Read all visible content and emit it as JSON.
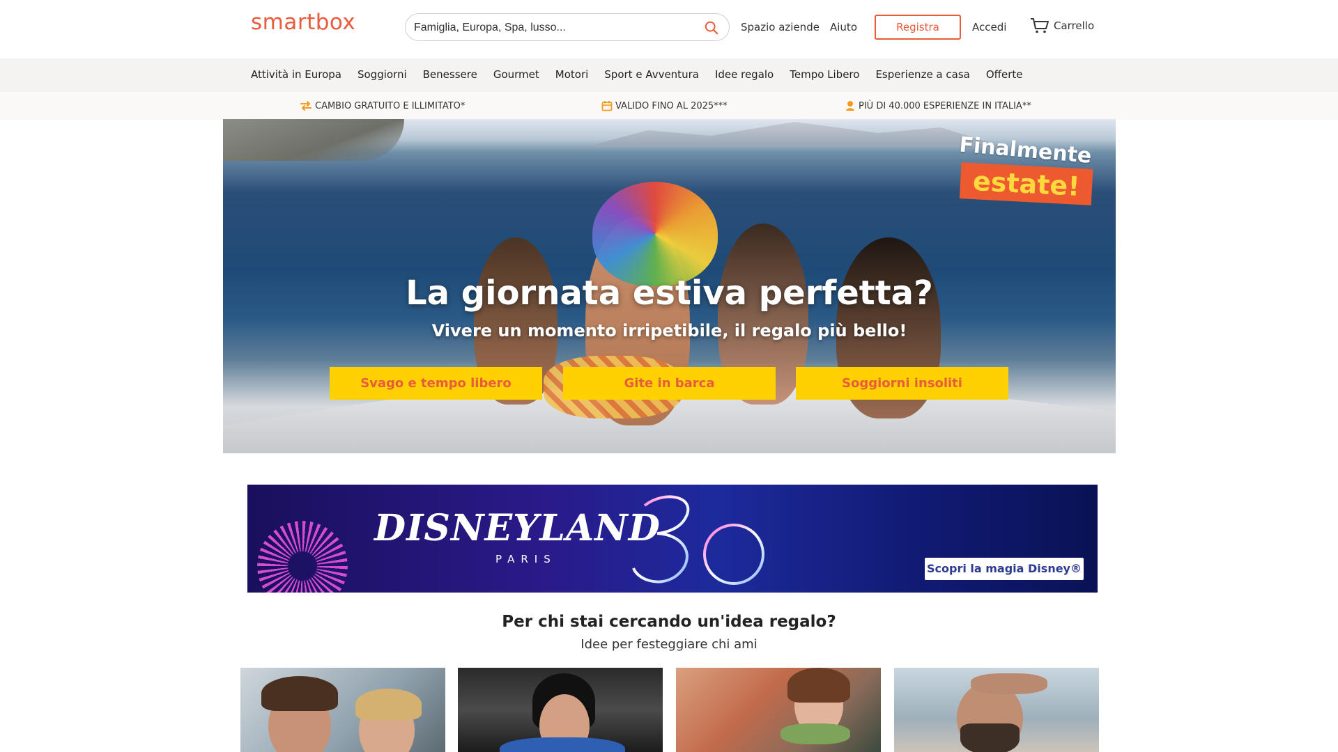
{
  "header": {
    "logo": "smartbox",
    "search_placeholder": "Famiglia, Europa, Spa, lusso...",
    "links": {
      "business": "Spazio aziende",
      "help": "Aiuto",
      "register": "Registra",
      "login": "Accedi",
      "cart": "Carrello"
    },
    "accent_color": "#ea5a3c"
  },
  "nav": {
    "items": [
      "Attività in Europa",
      "Soggiorni",
      "Benessere",
      "Gourmet",
      "Motori",
      "Sport e Avventura",
      "Idee regalo",
      "Tempo Libero",
      "Esperienze a casa",
      "Offerte"
    ]
  },
  "benefits": {
    "exchange": {
      "icon": "exchange-arrows-icon",
      "text": "CAMBIO GRATUITO E ILLIMITATO*"
    },
    "validity": {
      "icon": "calendar-icon",
      "text": "VALIDO FINO AL 2025***"
    },
    "experiences": {
      "icon": "location-person-icon",
      "text": "PIÙ DI 40.000 ESPERIENZE IN ITALIA**"
    }
  },
  "hero": {
    "sticker_line1": "Finalmente",
    "sticker_line2": "estate!",
    "title": "La giornata estiva perfetta?",
    "subtitle": "Vivere un momento irripetibile, il regalo più bello!",
    "buttons": [
      "Svago e tempo libero",
      "Gite in barca",
      "Soggiorni insoliti"
    ],
    "button_color": "#ffd100"
  },
  "promo": {
    "brand": "DISNEYLAND",
    "brand_sub": "PARIS",
    "anniversary": "30",
    "cta": "Scopri la magia Disney®"
  },
  "gift_section": {
    "title": "Per chi stai cercando un'idea regalo?",
    "subtitle": "Idee per festeggiare chi ami"
  }
}
